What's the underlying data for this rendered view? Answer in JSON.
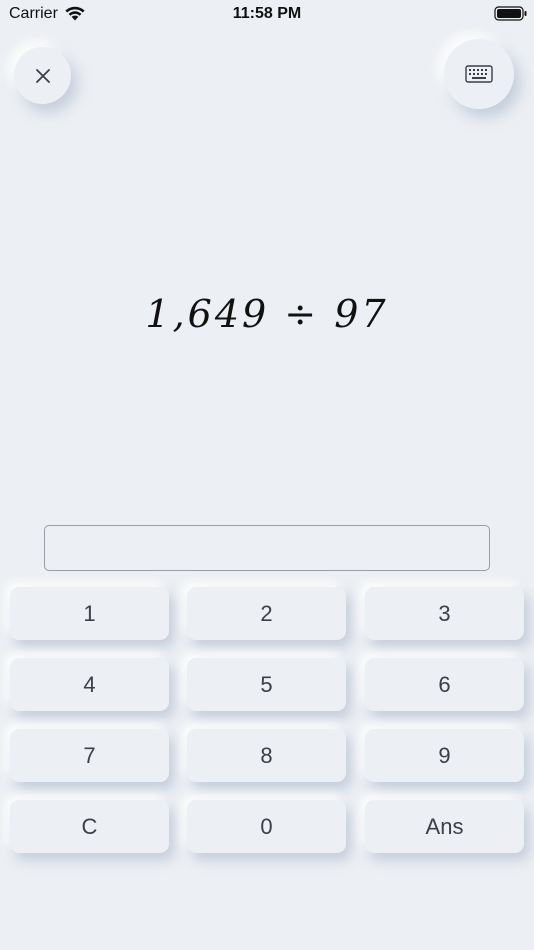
{
  "status_bar": {
    "carrier": "Carrier",
    "time": "11:58 PM"
  },
  "problem": {
    "expression": "1,649 ÷ 97"
  },
  "answer": {
    "value": "",
    "placeholder": ""
  },
  "keypad": {
    "keys": [
      "1",
      "2",
      "3",
      "4",
      "5",
      "6",
      "7",
      "8",
      "9",
      "C",
      "0",
      "Ans"
    ]
  },
  "icons": {
    "close": "close-icon",
    "keyboard": "keyboard-icon",
    "wifi": "wifi-icon",
    "battery": "battery-icon"
  },
  "colors": {
    "background": "#ECEFF3",
    "text": "#3b3f46"
  }
}
